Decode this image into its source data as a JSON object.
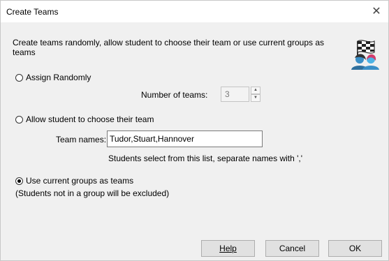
{
  "window": {
    "title": "Create Teams",
    "close_glyph": "✕"
  },
  "description": "Create teams randomly, allow student to choose their team or use current groups as teams",
  "logo_icon": "racing-flag-students-icon",
  "options": {
    "assign_randomly": {
      "label": "Assign Randomly",
      "checked": false
    },
    "number_of_teams_label": "Number of teams:",
    "number_of_teams_value": "3",
    "allow_choose": {
      "label": "Allow student to choose their team",
      "checked": false
    },
    "team_names_label": "Team names:",
    "team_names_value": "Tudor,Stuart,Hannover",
    "team_names_hint": "Students select from this list, separate names with ','",
    "use_groups": {
      "label": "Use current groups as teams",
      "checked": true
    },
    "use_groups_note": "(Students not in a group will be excluded)"
  },
  "buttons": {
    "help": "Help",
    "cancel": "Cancel",
    "ok": "OK"
  }
}
